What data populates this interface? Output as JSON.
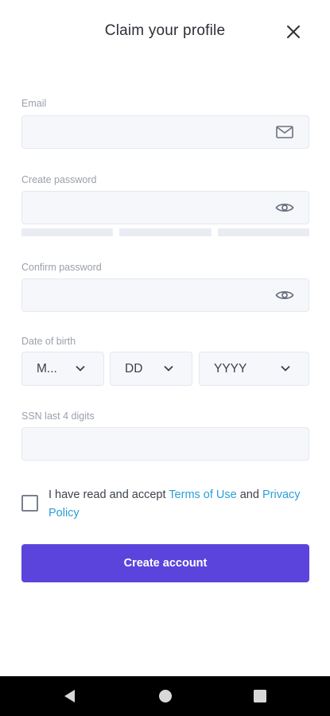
{
  "header": {
    "title": "Claim your profile",
    "close_icon": "close-icon"
  },
  "form": {
    "email": {
      "label": "Email",
      "value": "",
      "placeholder": "",
      "icon": "mail-icon"
    },
    "password": {
      "label": "Create password",
      "value": "",
      "placeholder": "",
      "icon": "eye-icon",
      "strength_segments": 3
    },
    "confirm_password": {
      "label": "Confirm password",
      "value": "",
      "placeholder": "",
      "icon": "eye-icon"
    },
    "dob": {
      "label": "Date of birth",
      "month": "M...",
      "day": "DD",
      "year": "YYYY"
    },
    "ssn": {
      "label": "SSN last 4 digits",
      "value": "",
      "placeholder": ""
    },
    "consent": {
      "checked": false,
      "text_before": "I have read and accept ",
      "terms_link": "Terms of Use",
      "text_middle": " and ",
      "privacy_link": "Privacy Policy"
    },
    "submit_label": "Create account"
  },
  "colors": {
    "primary": "#5a44dc",
    "link": "#2a9fd8",
    "field_bg": "#f5f7fb",
    "label": "#9aa0ab"
  },
  "navbar": {
    "back_icon": "back-triangle-icon",
    "home_icon": "home-circle-icon",
    "recents_icon": "recents-square-icon"
  }
}
